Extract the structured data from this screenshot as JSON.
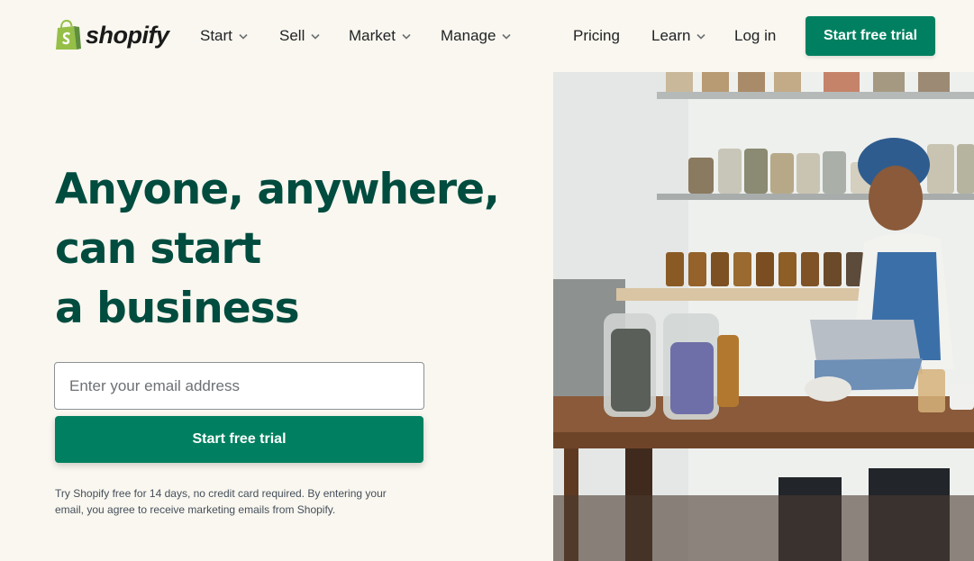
{
  "header": {
    "logo_text": "shopify",
    "nav": [
      {
        "label": "Start",
        "dropdown": true
      },
      {
        "label": "Sell",
        "dropdown": true
      },
      {
        "label": "Market",
        "dropdown": true
      },
      {
        "label": "Manage",
        "dropdown": true
      },
      {
        "label": "Pricing",
        "dropdown": false
      },
      {
        "label": "Learn",
        "dropdown": true
      },
      {
        "label": "Log in",
        "dropdown": false
      }
    ],
    "cta_label": "Start free trial"
  },
  "hero": {
    "headline_lines": [
      "Anyone, anywhere,",
      "can start",
      "a business"
    ],
    "email_placeholder": "Enter your email address",
    "cta_label": "Start free trial",
    "disclaimer": "Try Shopify free for 14 days, no credit card required. By entering your email, you agree to receive marketing emails from Shopify."
  },
  "colors": {
    "brand_green": "#008060",
    "headline_green": "#004c3f",
    "logo_green": "#95bf47",
    "background": "#f9f7ef"
  },
  "icons": {
    "logo": "shopify-bag-icon",
    "dropdown": "chevron-down-icon"
  }
}
